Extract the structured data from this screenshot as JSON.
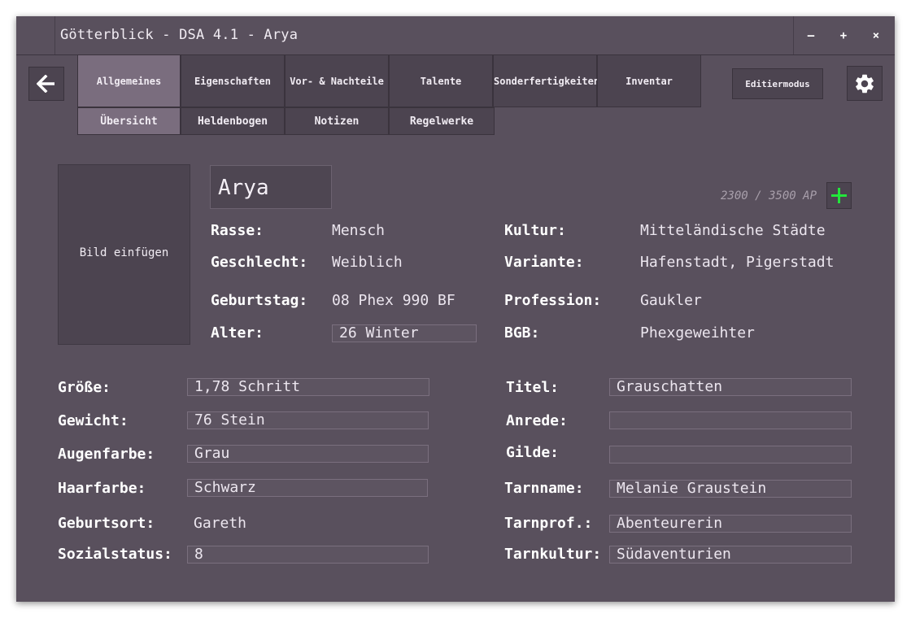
{
  "window": {
    "title": "Götterblick - DSA 4.1 - Arya",
    "minimize": "–",
    "maximize": "+",
    "close": "×"
  },
  "nav": {
    "back_icon": "arrow-left-icon",
    "tabs": [
      "Allgemeines",
      "Eigenschaften",
      "Vor- & Nachteile",
      "Talente",
      "Sonderfertigkeiten",
      "Inventar"
    ],
    "subtabs": [
      "Übersicht",
      "Heldenbogen",
      "Notizen",
      "Regelwerke"
    ],
    "edit_mode": "Editiermodus",
    "settings_icon": "gear-icon"
  },
  "hero": {
    "portrait_placeholder": "Bild einfügen",
    "name": "Arya",
    "ap": "2300 / 3500 AP",
    "add_ap_icon": "plus-icon"
  },
  "info_left": [
    {
      "label": "Rasse:",
      "value": "Mensch"
    },
    {
      "label": "Geschlecht:",
      "value": "Weiblich"
    },
    {
      "label": "Geburtstag:",
      "value": "08 Phex 990 BF"
    },
    {
      "label": "Alter:",
      "value": "26 Winter"
    }
  ],
  "info_right": [
    {
      "label": "Kultur:",
      "value": "Mitteländische Städte"
    },
    {
      "label": "Variante:",
      "value": "Hafenstadt, Pigerstadt"
    },
    {
      "label": "Profession:",
      "value": "Gaukler"
    },
    {
      "label": "BGB:",
      "value": "Phexgeweihter"
    }
  ],
  "details_left": [
    {
      "label": "Größe:",
      "value": "1,78 Schritt"
    },
    {
      "label": "Gewicht:",
      "value": "76 Stein"
    },
    {
      "label": "Augenfarbe:",
      "value": "Grau"
    },
    {
      "label": "Haarfarbe:",
      "value": "Schwarz"
    },
    {
      "label": "Geburtsort:",
      "value": "Gareth"
    },
    {
      "label": "Sozialstatus:",
      "value": "8"
    }
  ],
  "details_right": [
    {
      "label": "Titel:",
      "value": "Grauschatten"
    },
    {
      "label": "Anrede:",
      "value": ""
    },
    {
      "label": "Gilde:",
      "value": ""
    },
    {
      "label": "Tarnname:",
      "value": "Melanie Graustein"
    },
    {
      "label": "Tarnprof.:",
      "value": "Abenteurerin"
    },
    {
      "label": "Tarnkultur:",
      "value": "Südaventurien"
    }
  ],
  "colors": {
    "background": "#59505d",
    "tab_active": "#7a6d7e",
    "accent_plus": "#22e63b"
  }
}
